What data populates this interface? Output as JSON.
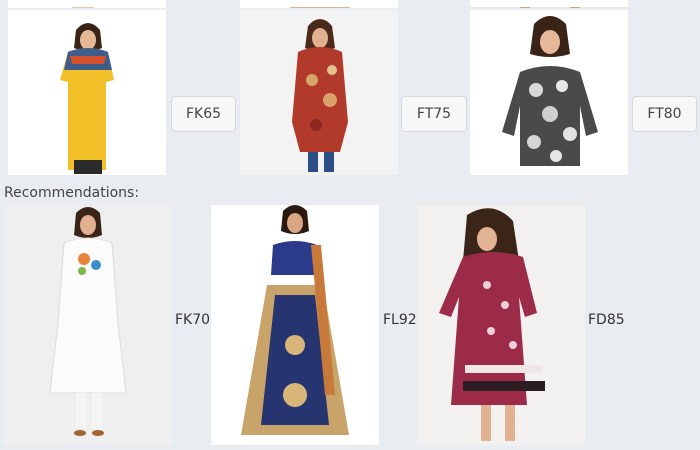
{
  "top_row": [
    {
      "code": "FK65",
      "alt": "yellow kurta with printed yoke"
    },
    {
      "code": "FT75",
      "alt": "red printed tunic"
    },
    {
      "code": "FT80",
      "alt": "black and white printed top"
    }
  ],
  "recommendations": {
    "heading": "Recommendations:",
    "items": [
      {
        "code": "FK70",
        "alt": "white kurta with embroidery"
      },
      {
        "code": "FL92",
        "alt": "blue embroidered lehenga"
      },
      {
        "code": "FD85",
        "alt": "pink printed dress"
      }
    ]
  },
  "colors": {
    "background": "#e9ecf1",
    "button_bg": "#f7f7f8",
    "button_border": "#d5d8dc",
    "text": "#444444"
  }
}
